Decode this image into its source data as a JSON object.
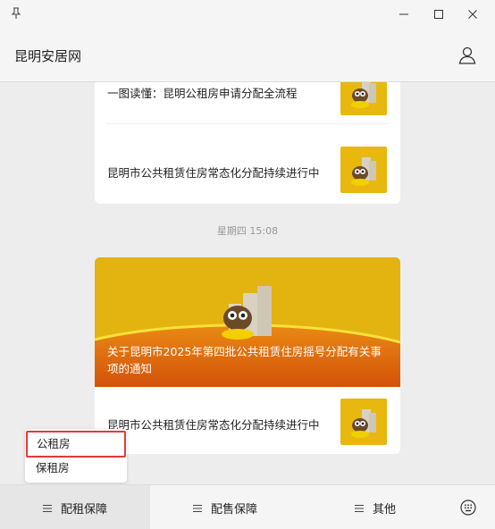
{
  "window": {
    "title": "昆明安居网",
    "icons": [
      "pin-icon",
      "minimize-icon",
      "maximize-icon",
      "close-icon",
      "user-icon"
    ]
  },
  "messages": {
    "card1": {
      "items": [
        {
          "title": "一图读懂：昆明公租房申请分配全流程"
        },
        {
          "title": "昆明市公共租赁住房常态化分配持续进行中"
        }
      ]
    },
    "timestamp": "星期四 15:08",
    "card2": {
      "banner_title": "关于昆明市2025年第四批公共租赁住房摇号分配有关事项的通知",
      "items": [
        {
          "title": "昆明市公共租赁住房常态化分配持续进行中"
        }
      ]
    }
  },
  "popup_menu": {
    "options": [
      "公租房",
      "保租房"
    ],
    "highlighted": "公租房"
  },
  "bottom_menu": {
    "tabs": [
      "配租保障",
      "配售保障",
      "其他"
    ],
    "active": "配租保障",
    "keyboard_icon": "keyboard-icon"
  },
  "colors": {
    "accent_yellow": "#e3b310",
    "banner_orange": "#d9600a",
    "highlight_red": "#e53935"
  }
}
